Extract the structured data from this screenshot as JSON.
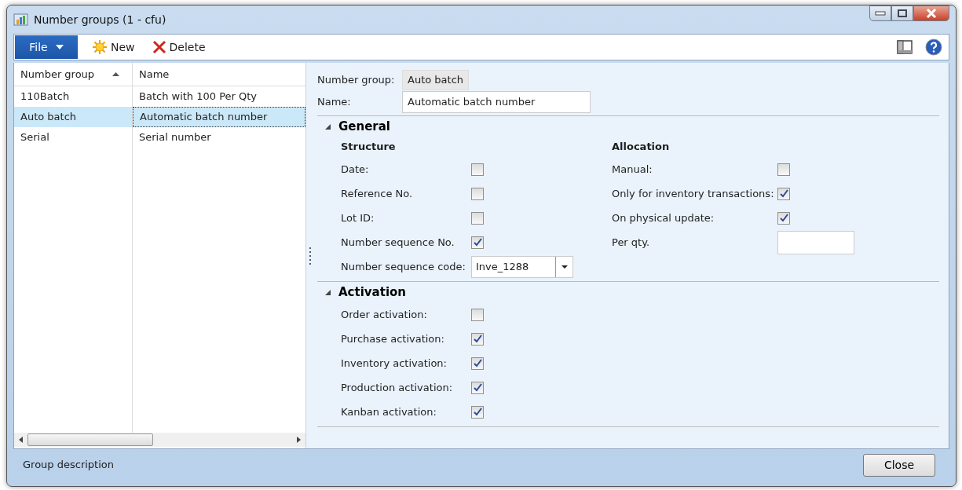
{
  "window": {
    "title": "Number groups (1 - cfu)"
  },
  "toolbar": {
    "file_menu": "File",
    "buttons": [
      {
        "kind": "new",
        "label": "New"
      },
      {
        "kind": "delete",
        "label": "Delete"
      }
    ]
  },
  "grid": {
    "columns": [
      {
        "label": "Number group",
        "sorted": true
      },
      {
        "label": "Name",
        "sorted": false
      }
    ],
    "rows": [
      {
        "cells": [
          "110Batch",
          "Batch with 100 Per Qty"
        ],
        "selected": false
      },
      {
        "cells": [
          "Auto batch",
          "Automatic batch number"
        ],
        "selected": true
      },
      {
        "cells": [
          "Serial",
          "Serial number"
        ],
        "selected": false
      }
    ]
  },
  "header": {
    "number_group": {
      "label": "Number group:",
      "value": "Auto batch"
    },
    "name": {
      "label": "Name:",
      "value": "Automatic batch number"
    }
  },
  "sections": [
    {
      "title": "General",
      "expanded": true,
      "groups": [
        {
          "title": "Structure",
          "fields": [
            {
              "kind": "checkbox",
              "label": "Date:",
              "checked": false
            },
            {
              "kind": "checkbox",
              "label": "Reference No.",
              "checked": false
            },
            {
              "kind": "checkbox",
              "label": "Lot ID:",
              "checked": false
            },
            {
              "kind": "checkbox",
              "label": "Number sequence No.",
              "checked": true
            },
            {
              "kind": "combo",
              "label": "Number sequence code:",
              "value": "Inve_1288"
            }
          ]
        },
        {
          "title": "Allocation",
          "fields": [
            {
              "kind": "checkbox",
              "label": "Manual:",
              "checked": false
            },
            {
              "kind": "checkbox",
              "label": "Only for inventory transactions:",
              "checked": true
            },
            {
              "kind": "checkbox",
              "label": "On physical update:",
              "checked": true
            },
            {
              "kind": "input",
              "label": "Per qty."
            }
          ]
        }
      ]
    },
    {
      "title": "Activation",
      "expanded": true,
      "groups": [
        {
          "fields": [
            {
              "kind": "checkbox",
              "label": "Order activation:",
              "checked": false
            },
            {
              "kind": "checkbox",
              "label": "Purchase activation:",
              "checked": true
            },
            {
              "kind": "checkbox",
              "label": "Inventory activation:",
              "checked": true
            },
            {
              "kind": "checkbox",
              "label": "Production activation:",
              "checked": true
            },
            {
              "kind": "checkbox",
              "label": "Kanban activation:",
              "checked": true
            }
          ]
        }
      ]
    }
  ],
  "status_bar": {
    "text": "Group description",
    "close_button": "Close"
  }
}
